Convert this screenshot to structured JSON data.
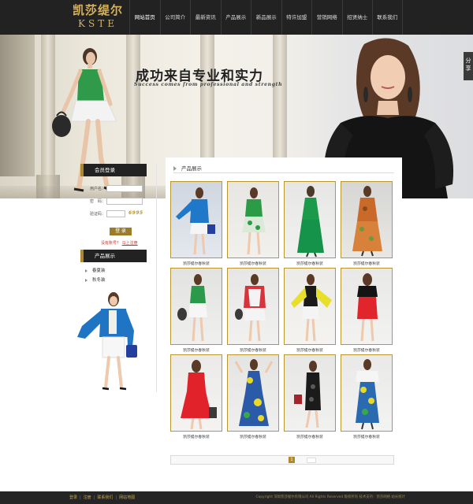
{
  "header": {
    "logo_cn": "凯莎缇尔",
    "logo_en": "KSTE",
    "nav": [
      {
        "label": "网站首页"
      },
      {
        "label": "公司简介"
      },
      {
        "label": "最新资讯"
      },
      {
        "label": "产品展示"
      },
      {
        "label": "新品展示"
      },
      {
        "label": "特许加盟"
      },
      {
        "label": "营销网络"
      },
      {
        "label": "招贤纳士"
      },
      {
        "label": "联系我们"
      }
    ]
  },
  "banner": {
    "title": "成功来自专业和实力",
    "subtitle": "Success comes from professional and strength"
  },
  "share_tab": "分享",
  "sidebar": {
    "login_title": "会员登录",
    "username_label": "用户名：",
    "password_label": "密　码：",
    "captcha_label": "验证码：",
    "captcha_code": "6995",
    "login_button": "登 录",
    "no_account_text": "没有账号？",
    "register_link": "马上注册",
    "category_title": "产品展示",
    "categories": [
      {
        "label": "春夏装"
      },
      {
        "label": "秋冬装"
      }
    ]
  },
  "main": {
    "section_title": "产品展示",
    "products": [
      {
        "name": "凯莎缇尔春秋装"
      },
      {
        "name": "凯莎缇尔春秋装"
      },
      {
        "name": "凯莎缇尔春秋装"
      },
      {
        "name": "凯莎缇尔春秋装"
      },
      {
        "name": "凯莎缇尔春秋装"
      },
      {
        "name": "凯莎缇尔春秋装"
      },
      {
        "name": "凯莎缇尔春秋装"
      },
      {
        "name": "凯莎缇尔春秋装"
      },
      {
        "name": "凯莎缇尔春秋装"
      },
      {
        "name": "凯莎缇尔春秋装"
      },
      {
        "name": "凯莎缇尔春秋装"
      },
      {
        "name": "凯莎缇尔春秋装"
      }
    ],
    "pager_current": "1"
  },
  "footer": {
    "links": [
      {
        "label": "登录"
      },
      {
        "label": "注册"
      },
      {
        "label": "联系我们"
      },
      {
        "label": "网站地图"
      }
    ],
    "copyright": "Copyright 深圳凯莎缇尔有限公司 All Rights Reserved 版权所有 技术支持：凯莎网络 站长统计"
  },
  "colors": {
    "header_bg": "#222222",
    "gold": "#b0882c",
    "logo_gold": "#d6b25a",
    "frame_gold": "#b8972c",
    "link_red": "#c0392b"
  }
}
